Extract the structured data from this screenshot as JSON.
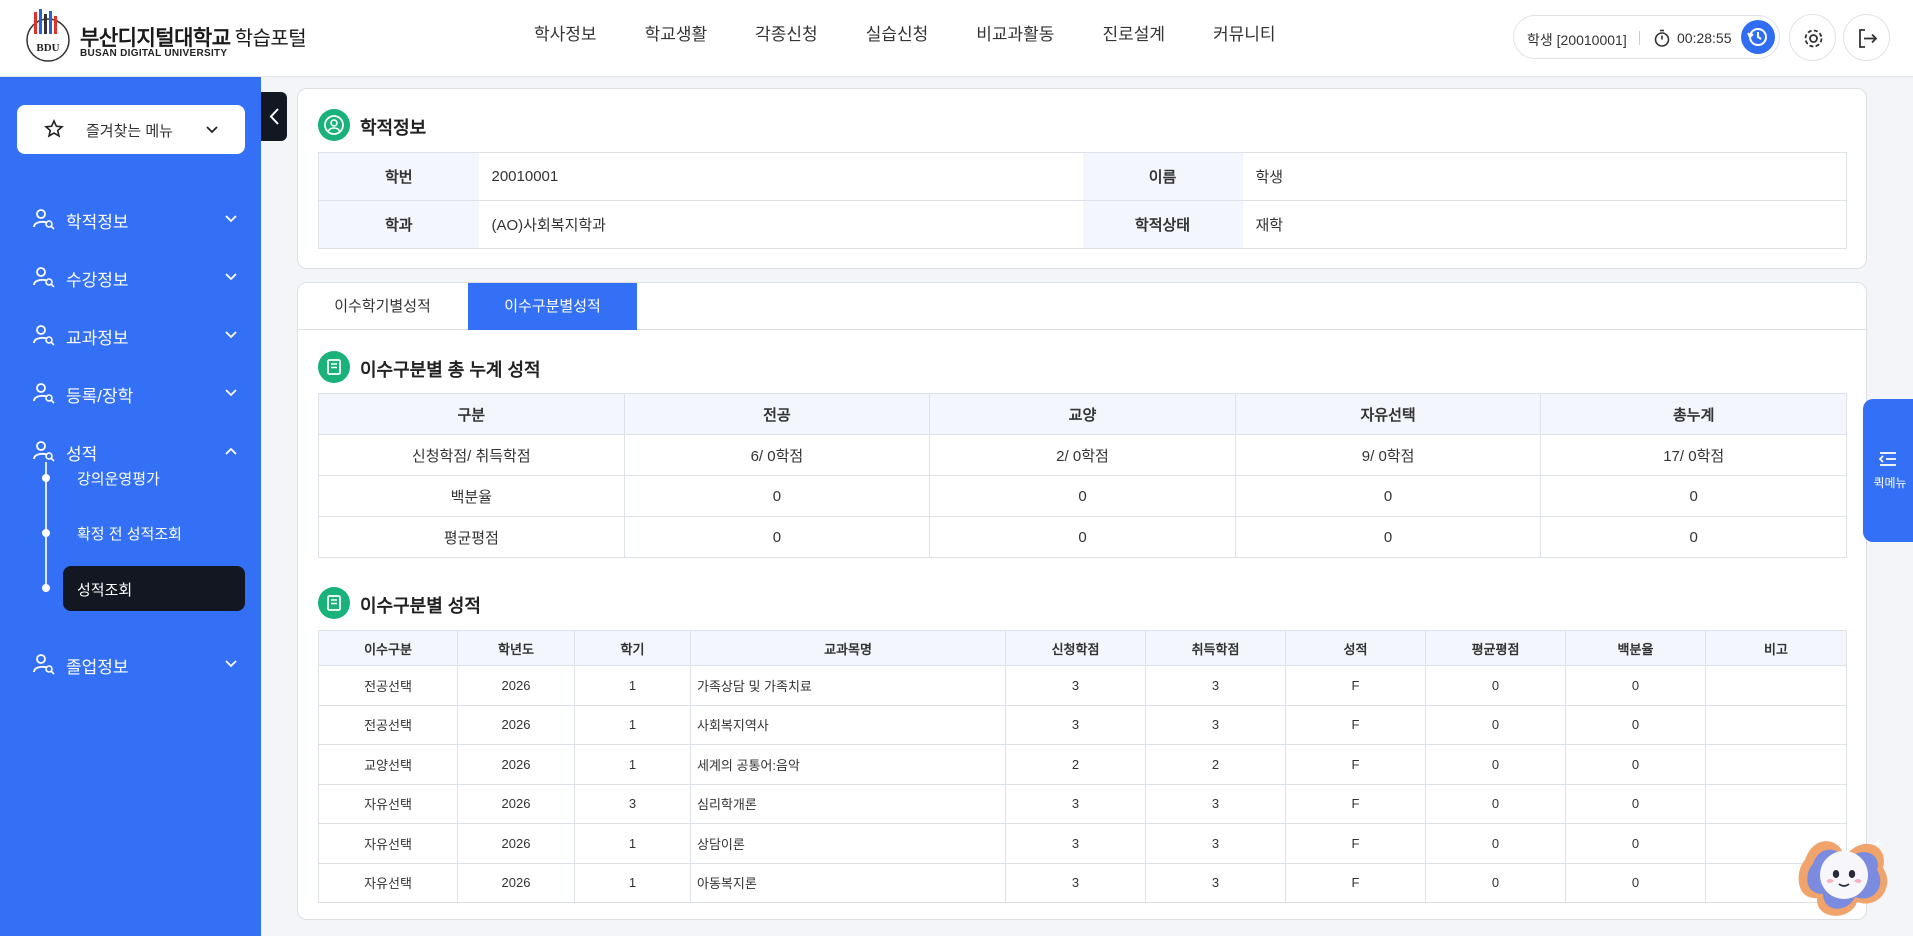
{
  "header": {
    "logo_text": "BDU",
    "university_name": "부산디지털대학교",
    "portal_name": "학습포털",
    "university_name_en": "BUSAN DIGITAL UNIVERSITY",
    "nav": [
      "학사정보",
      "학교생활",
      "각종신청",
      "실습신청",
      "비교과활동",
      "진로설계",
      "커뮤니티"
    ],
    "user_label": "학생 [20010001]",
    "timer": "00:28:55"
  },
  "sidebar": {
    "favorites_label": "즐겨찾는 메뉴",
    "menus": [
      "학적정보",
      "수강정보",
      "교과정보",
      "등록/장학",
      "성적",
      "졸업정보"
    ],
    "sub_items": [
      "강의운영평가",
      "확정 전 성적조회",
      "성적조회"
    ],
    "active_sub": "성적조회"
  },
  "student_info": {
    "title": "학적정보",
    "fields": {
      "student_no_label": "학번",
      "student_no": "20010001",
      "name_label": "이름",
      "name": "학생",
      "dept_label": "학과",
      "dept": "(AO)사회복지학과",
      "status_label": "학적상태",
      "status": "재학"
    }
  },
  "tabs": [
    "이수학기별성적",
    "이수구분별성적"
  ],
  "active_tab": "이수구분별성적",
  "summary": {
    "title": "이수구분별 총 누계 성적",
    "headers": [
      "구분",
      "전공",
      "교양",
      "자유선택",
      "총누계"
    ],
    "rows": [
      [
        "신청학점/ 취득학점",
        "6/ 0학점",
        "2/ 0학점",
        "9/ 0학점",
        "17/ 0학점"
      ],
      [
        "백분율",
        "0",
        "0",
        "0",
        "0"
      ],
      [
        "평균평점",
        "0",
        "0",
        "0",
        "0"
      ]
    ]
  },
  "grades": {
    "title": "이수구분별 성적",
    "headers": [
      "이수구분",
      "학년도",
      "학기",
      "교과목명",
      "신청학점",
      "취득학점",
      "성적",
      "평균평점",
      "백분율",
      "비고"
    ],
    "rows": [
      [
        "전공선택",
        "2026",
        "1",
        "가족상담 및 가족치료",
        "3",
        "3",
        "F",
        "0",
        "0",
        ""
      ],
      [
        "전공선택",
        "2026",
        "1",
        "사회복지역사",
        "3",
        "3",
        "F",
        "0",
        "0",
        ""
      ],
      [
        "교양선택",
        "2026",
        "1",
        "세계의 공통어:음악",
        "2",
        "2",
        "F",
        "0",
        "0",
        ""
      ],
      [
        "자유선택",
        "2026",
        "3",
        "심리학개론",
        "3",
        "3",
        "F",
        "0",
        "0",
        ""
      ],
      [
        "자유선택",
        "2026",
        "1",
        "상담이론",
        "3",
        "3",
        "F",
        "0",
        "0",
        ""
      ],
      [
        "자유선택",
        "2026",
        "1",
        "아동복지론",
        "3",
        "3",
        "F",
        "0",
        "0",
        ""
      ]
    ]
  },
  "quick_menu_label": "퀵메뉴",
  "colors": {
    "primary": "#3370f5",
    "dark": "#121722",
    "section_icon": "#18b27a"
  }
}
